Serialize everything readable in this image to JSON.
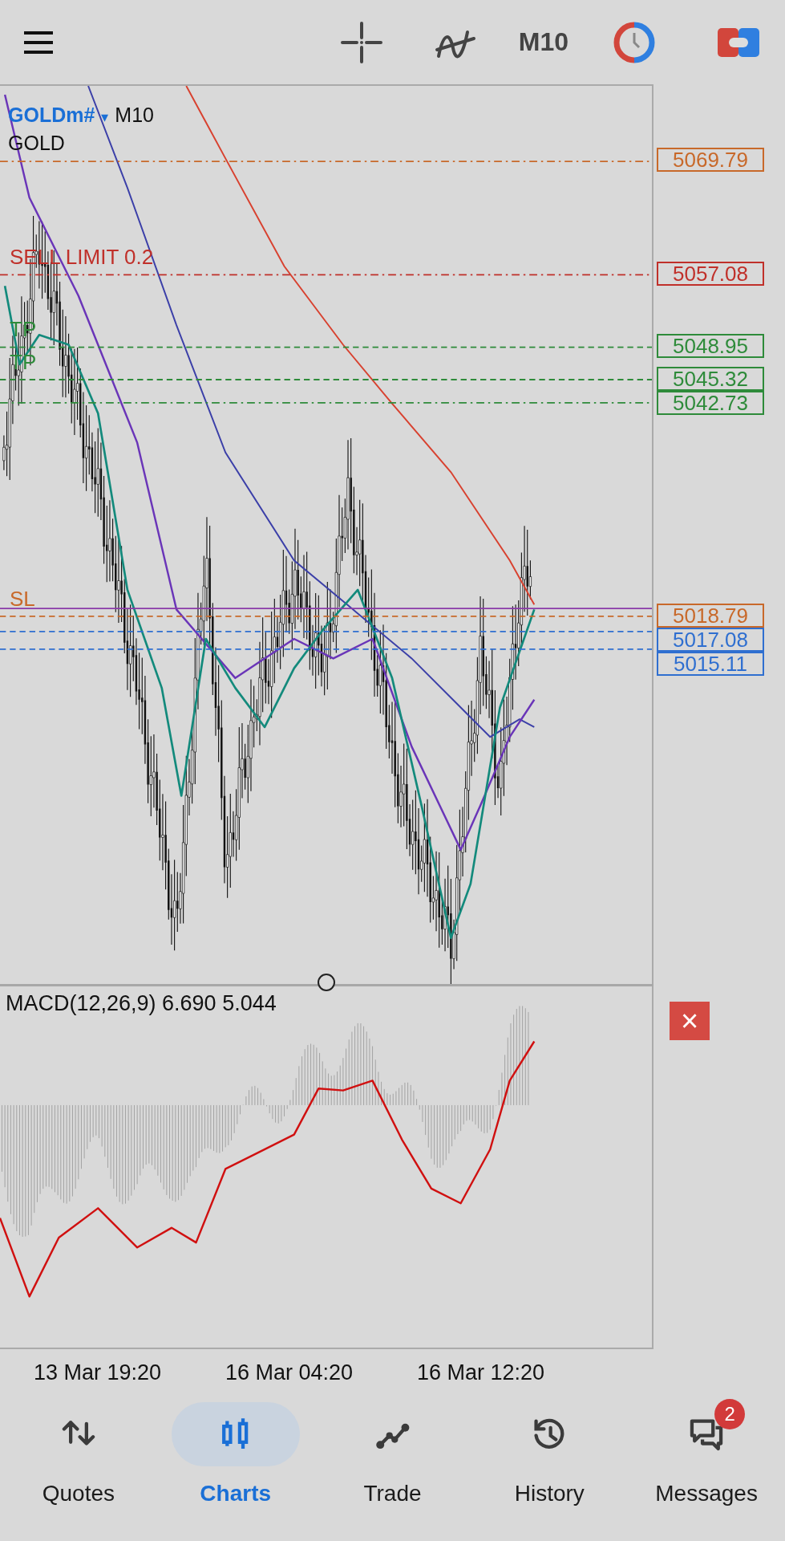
{
  "toolbar": {
    "timeframe": "M10"
  },
  "chart": {
    "symbol": "GOLDm#",
    "caret": "▾",
    "timeframe": "M10",
    "description": "GOLD",
    "levels": [
      {
        "price": "5069.79",
        "color": "#c8692a"
      },
      {
        "price": "5057.08",
        "color": "#c0302a",
        "label": "SELL LIMIT 0.2"
      },
      {
        "price": "5048.95",
        "color": "#2e8b3a",
        "label": "TP"
      },
      {
        "price": "5045.32",
        "color": "#2e8b3a",
        "label": "TP"
      },
      {
        "price": "5042.73",
        "color": "#2e8b3a"
      },
      {
        "price": "5018.79",
        "color": "#c8692a",
        "label": "SL"
      },
      {
        "price": "5017.08",
        "color": "#2f6fd0"
      },
      {
        "price": "5015.11",
        "color": "#2f6fd0"
      }
    ]
  },
  "macd": {
    "label": "MACD(12,26,9) 6.690 5.044",
    "close": "×"
  },
  "time_axis": [
    "13 Mar 19:20",
    "16 Mar 04:20",
    "16 Mar 12:20"
  ],
  "nav": [
    {
      "label": "Quotes",
      "selected": false
    },
    {
      "label": "Charts",
      "selected": true
    },
    {
      "label": "Trade",
      "selected": false
    },
    {
      "label": "History",
      "selected": false
    },
    {
      "label": "Messages",
      "selected": false,
      "badge": "2"
    }
  ]
}
